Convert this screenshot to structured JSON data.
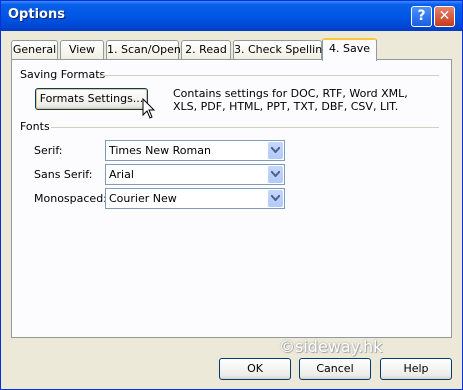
{
  "window": {
    "title": "Options"
  },
  "titlebar": {
    "help_icon": "question-mark",
    "close_icon": "x"
  },
  "tabs": [
    {
      "label": "General"
    },
    {
      "label": "View"
    },
    {
      "label": "1. Scan/Open"
    },
    {
      "label": "2. Read"
    },
    {
      "label": "3. Check Spelling"
    },
    {
      "label": "4. Save",
      "active": true
    }
  ],
  "saving": {
    "group_label": "Saving Formats",
    "button_label": "Formats Settings...",
    "description": "Contains settings for DOC, RTF, Word XML, XLS, PDF, HTML, PPT, TXT, DBF, CSV, LIT."
  },
  "fonts": {
    "group_label": "Fonts",
    "serif": {
      "label": "Serif:",
      "value": "Times New Roman"
    },
    "sans_serif": {
      "label": "Sans Serif:",
      "value": "Arial"
    },
    "monospaced": {
      "label": "Monospaced:",
      "value": "Courier New"
    }
  },
  "footer": {
    "ok": "OK",
    "cancel": "Cancel",
    "help": "Help"
  },
  "watermark": "©sideway.hk"
}
